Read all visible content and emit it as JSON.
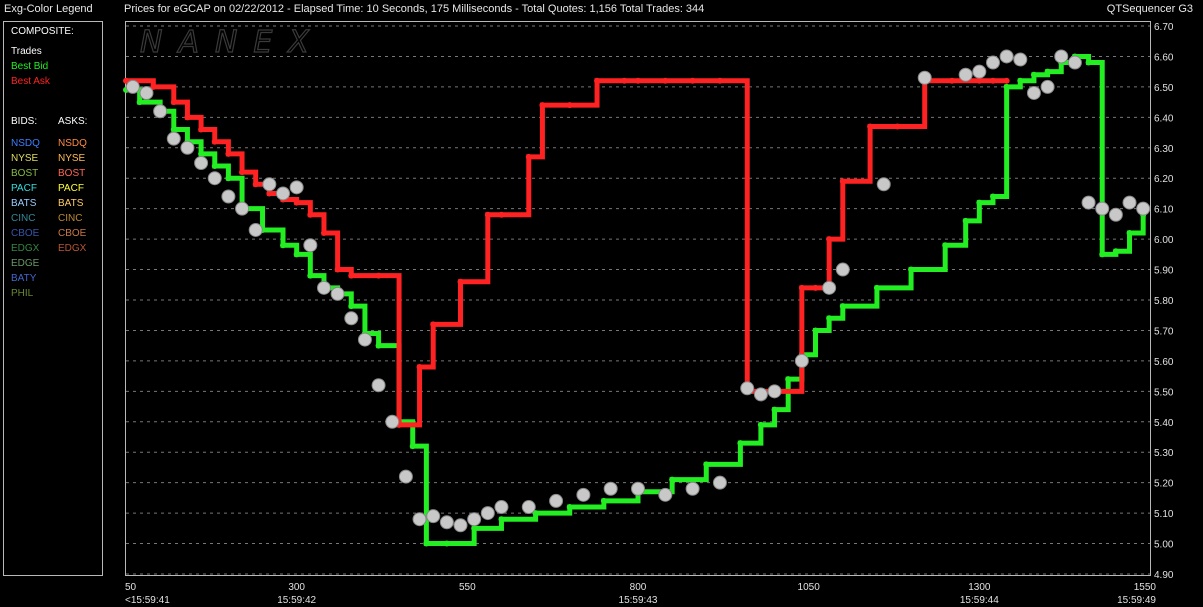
{
  "titlebar": {
    "legend_title": "Exg-Color Legend",
    "info": "Prices for  eGCAP  on  02/22/2012  -  Elapsed Time: 10 Seconds, 175 Milliseconds  -  Total Quotes: 1,156  Total Trades: 344",
    "app_name": "QTSequencer G3"
  },
  "legend": {
    "composite_header": "COMPOSITE:",
    "composite": [
      {
        "label": "Trades",
        "color": "#ffffff"
      },
      {
        "label": "Best Bid",
        "color": "#22ee22"
      },
      {
        "label": "Best Ask",
        "color": "#ff2222"
      }
    ],
    "bids_header": "BIDS:",
    "asks_header": "ASKS:",
    "bids": [
      {
        "label": "NSDQ",
        "color": "#3a7fff"
      },
      {
        "label": "NYSE",
        "color": "#dcdc60"
      },
      {
        "label": "BOST",
        "color": "#88bb44"
      },
      {
        "label": "PACF",
        "color": "#33dddd"
      },
      {
        "label": "BATS",
        "color": "#99ccff"
      },
      {
        "label": "CINC",
        "color": "#338899"
      },
      {
        "label": "CBOE",
        "color": "#3355aa"
      },
      {
        "label": "EDGX",
        "color": "#338844"
      },
      {
        "label": "EDGE",
        "color": "#669966"
      },
      {
        "label": "BATY",
        "color": "#4466cc"
      },
      {
        "label": "PHIL",
        "color": "#668833"
      }
    ],
    "asks": [
      {
        "label": "NSDQ",
        "color": "#ff8844"
      },
      {
        "label": "NYSE",
        "color": "#ffbb55"
      },
      {
        "label": "BOST",
        "color": "#ff6655"
      },
      {
        "label": "PACF",
        "color": "#ffff33"
      },
      {
        "label": "BATS",
        "color": "#ffcc66"
      },
      {
        "label": "CINC",
        "color": "#bb8833"
      },
      {
        "label": "CBOE",
        "color": "#cc7744"
      },
      {
        "label": "EDGX",
        "color": "#bb5533"
      }
    ]
  },
  "watermark": "NANEX",
  "chart_data": {
    "type": "line",
    "grid": true,
    "ylim": [
      4.9,
      6.7
    ],
    "y_ticks": [
      "4.90",
      "5.00",
      "5.10",
      "5.20",
      "5.30",
      "5.40",
      "5.50",
      "5.60",
      "5.70",
      "5.80",
      "5.90",
      "6.00",
      "6.10",
      "6.20",
      "6.30",
      "6.40",
      "6.50",
      "6.60",
      "6.70"
    ],
    "xlim": [
      50,
      1550
    ],
    "x_ticks": [
      {
        "x": 50,
        "label": "50",
        "time": "<15:59:41"
      },
      {
        "x": 300,
        "label": "300",
        "time": "15:59:42"
      },
      {
        "x": 550,
        "label": "550",
        "time": ""
      },
      {
        "x": 800,
        "label": "800",
        "time": "15:59:43"
      },
      {
        "x": 1050,
        "label": "1050",
        "time": ""
      },
      {
        "x": 1300,
        "label": "1300",
        "time": "15:59:44"
      },
      {
        "x": 1550,
        "label": "1550",
        "time": "15:59:49"
      }
    ],
    "series": [
      {
        "name": "Best Bid",
        "color": "#22ee22",
        "x": [
          50,
          70,
          100,
          120,
          140,
          160,
          180,
          200,
          220,
          250,
          280,
          300,
          320,
          340,
          360,
          380,
          400,
          420,
          450,
          470,
          490,
          520,
          560,
          600,
          650,
          700,
          750,
          800,
          850,
          900,
          950,
          980,
          1000,
          1020,
          1040,
          1060,
          1080,
          1100,
          1150,
          1200,
          1250,
          1280,
          1300,
          1320,
          1340,
          1360,
          1380,
          1400,
          1420,
          1440,
          1460,
          1480,
          1500,
          1520,
          1540
        ],
        "y": [
          6.49,
          6.45,
          6.42,
          6.36,
          6.32,
          6.28,
          6.24,
          6.2,
          6.1,
          6.03,
          5.98,
          5.95,
          5.88,
          5.84,
          5.82,
          5.78,
          5.69,
          5.65,
          5.4,
          5.32,
          5.0,
          5.0,
          5.05,
          5.08,
          5.1,
          5.12,
          5.14,
          5.17,
          5.21,
          5.26,
          5.33,
          5.39,
          5.44,
          5.54,
          5.62,
          5.7,
          5.74,
          5.78,
          5.84,
          5.9,
          5.98,
          6.06,
          6.12,
          6.14,
          6.5,
          6.52,
          6.54,
          6.55,
          6.58,
          6.6,
          6.58,
          5.95,
          5.96,
          6.02,
          6.08
        ]
      },
      {
        "name": "Best Ask",
        "color": "#ff2222",
        "x": [
          50,
          90,
          120,
          140,
          160,
          180,
          200,
          220,
          240,
          260,
          280,
          300,
          320,
          340,
          360,
          380,
          420,
          450,
          480,
          500,
          540,
          580,
          600,
          640,
          660,
          700,
          740,
          780,
          800,
          840,
          880,
          920,
          960,
          980,
          1000,
          1040,
          1060,
          1080,
          1100,
          1140,
          1180,
          1220,
          1260,
          1300,
          1320,
          1340
        ],
        "y": [
          6.52,
          6.5,
          6.45,
          6.4,
          6.36,
          6.32,
          6.28,
          6.22,
          6.18,
          6.15,
          6.13,
          6.12,
          6.08,
          6.02,
          5.9,
          5.88,
          5.88,
          5.39,
          5.58,
          5.72,
          5.86,
          6.08,
          6.08,
          6.27,
          6.44,
          6.44,
          6.52,
          6.52,
          6.52,
          6.52,
          6.52,
          6.52,
          5.5,
          5.5,
          5.5,
          5.84,
          5.84,
          6.0,
          6.19,
          6.37,
          6.37,
          6.52,
          6.52,
          6.52,
          6.52,
          6.52
        ]
      },
      {
        "name": "Trades",
        "color": "#cccccc",
        "x": [
          60,
          80,
          100,
          120,
          140,
          160,
          180,
          200,
          220,
          240,
          260,
          280,
          300,
          320,
          340,
          360,
          380,
          400,
          420,
          440,
          460,
          480,
          500,
          520,
          540,
          560,
          580,
          600,
          640,
          680,
          720,
          760,
          800,
          840,
          880,
          920,
          960,
          980,
          1000,
          1040,
          1080,
          1100,
          1160,
          1220,
          1280,
          1300,
          1320,
          1340,
          1360,
          1380,
          1400,
          1420,
          1440,
          1460,
          1480,
          1500,
          1520,
          1540
        ],
        "y": [
          6.5,
          6.48,
          6.42,
          6.33,
          6.3,
          6.25,
          6.2,
          6.14,
          6.1,
          6.03,
          6.18,
          6.15,
          6.17,
          5.98,
          5.84,
          5.82,
          5.74,
          5.67,
          5.52,
          5.4,
          5.22,
          5.08,
          5.09,
          5.07,
          5.06,
          5.08,
          5.1,
          5.12,
          5.12,
          5.14,
          5.16,
          5.18,
          5.18,
          5.16,
          5.18,
          5.2,
          5.51,
          5.49,
          5.5,
          5.6,
          5.84,
          5.9,
          6.18,
          6.53,
          6.54,
          6.55,
          6.58,
          6.6,
          6.59,
          6.48,
          6.5,
          6.6,
          6.58,
          6.12,
          6.1,
          6.08,
          6.12,
          6.1
        ]
      }
    ]
  }
}
